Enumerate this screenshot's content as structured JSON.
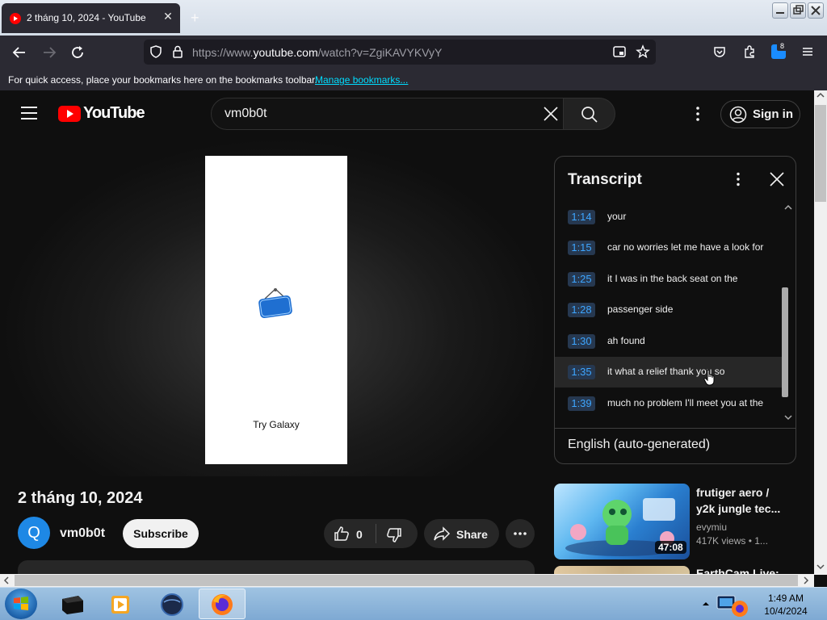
{
  "browser": {
    "tab_title": "2 tháng 10, 2024 - YouTube",
    "url_prefix": "https://www.",
    "url_domain": "youtube.com",
    "url_path": "/watch?v=ZgiKAVYKVyY",
    "extension_badge": "8",
    "bookmarks_message": "For quick access, place your bookmarks here on the bookmarks toolbar.",
    "bookmarks_link": "Manage bookmarks..."
  },
  "youtube": {
    "logo_text": "YouTube",
    "search_value": "vm0b0t",
    "sign_in_label": "Sign in"
  },
  "video": {
    "ad_caption": "Try Galaxy",
    "title": "2 tháng 10, 2024",
    "channel_initial": "Q",
    "channel_name": "vm0b0t",
    "subscribe_label": "Subscribe",
    "like_count": "0",
    "share_label": "Share"
  },
  "transcript": {
    "title": "Transcript",
    "segments": [
      {
        "time": "1:14",
        "text": "your"
      },
      {
        "time": "1:15",
        "text": "car no worries let me have a look for"
      },
      {
        "time": "1:25",
        "text": "it I was in the back seat on the"
      },
      {
        "time": "1:28",
        "text": "passenger side"
      },
      {
        "time": "1:30",
        "text": "ah found"
      },
      {
        "time": "1:35",
        "text": "it what a relief thank you so"
      },
      {
        "time": "1:39",
        "text": "much no problem I'll meet you at the"
      }
    ],
    "language": "English (auto-generated)"
  },
  "recommendations": [
    {
      "title_line1": "frutiger aero /",
      "title_line2": "y2k jungle tec...",
      "channel": "evymiu",
      "meta": "417K views  • 1...",
      "duration": "47:08"
    },
    {
      "title_line1": "EarthCam Live:"
    }
  ],
  "taskbar": {
    "time": "1:49 AM",
    "date": "10/4/2024"
  },
  "colors": {
    "youtube_red": "#ff0000",
    "timestamp_blue": "#3ea6ff",
    "background": "#0f0f0f"
  }
}
